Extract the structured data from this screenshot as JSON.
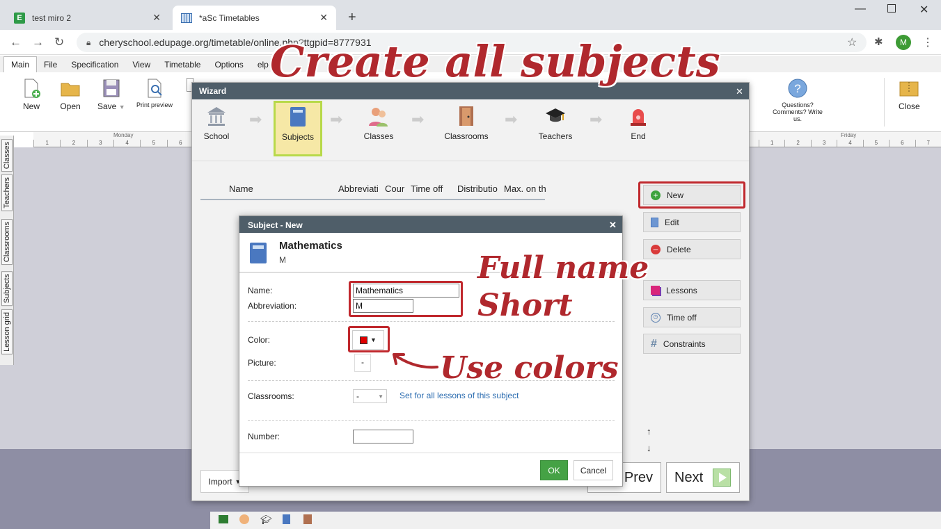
{
  "browser": {
    "tabs": [
      {
        "title": "test miro 2"
      },
      {
        "title": "*aSc Timetables"
      }
    ],
    "url": "cheryschool.edupage.org/timetable/online.ph",
    "url_tail": "ttgpid=8777931",
    "avatar_letter": "M"
  },
  "menubar": [
    "Main",
    "File",
    "Specification",
    "View",
    "Timetable",
    "Options",
    "elp"
  ],
  "ribbon": {
    "new": "New",
    "open": "Open",
    "save": "Save",
    "print_preview": "Print preview",
    "questions": "Questions? Comments? Write us.",
    "close": "Close"
  },
  "grid": {
    "monday": "Monday",
    "friday": "Friday",
    "periods": [
      "1",
      "2",
      "3",
      "4",
      "5",
      "6",
      "7"
    ]
  },
  "sidetabs": [
    "Classes",
    "Teachers",
    "Classrooms",
    "Subjects",
    "Lesson grid"
  ],
  "wizard": {
    "title": "Wizard",
    "steps": [
      "School",
      "Subjects",
      "Classes",
      "Classrooms",
      "Teachers",
      "End"
    ],
    "columns": [
      "Name",
      "Abbreviati",
      "Cour",
      "Time off",
      "Distributio",
      "Max. on th"
    ],
    "side_buttons": [
      "New",
      "Edit",
      "Delete",
      "Lessons",
      "Time off",
      "Constraints"
    ],
    "import": "Import",
    "prev": "Prev",
    "next": "Next"
  },
  "dialog": {
    "title": "Subject - New",
    "header_name": "Mathematics",
    "header_abbr": "M",
    "name_label": "Name:",
    "name_value": "Mathematics",
    "abbr_label": "Abbreviation:",
    "abbr_value": "M",
    "color_label": "Color:",
    "color_value": "#e00000",
    "picture_label": "Picture:",
    "picture_value": "-",
    "classrooms_label": "Classrooms:",
    "classrooms_value": "-",
    "classrooms_link": "Set for all lessons of this subject",
    "number_label": "Number:",
    "ok": "OK",
    "cancel": "Cancel"
  },
  "annotations": {
    "headline": "Create all subjects",
    "full_name": "Full name",
    "short": "Short",
    "use_colors": "Use colors"
  }
}
